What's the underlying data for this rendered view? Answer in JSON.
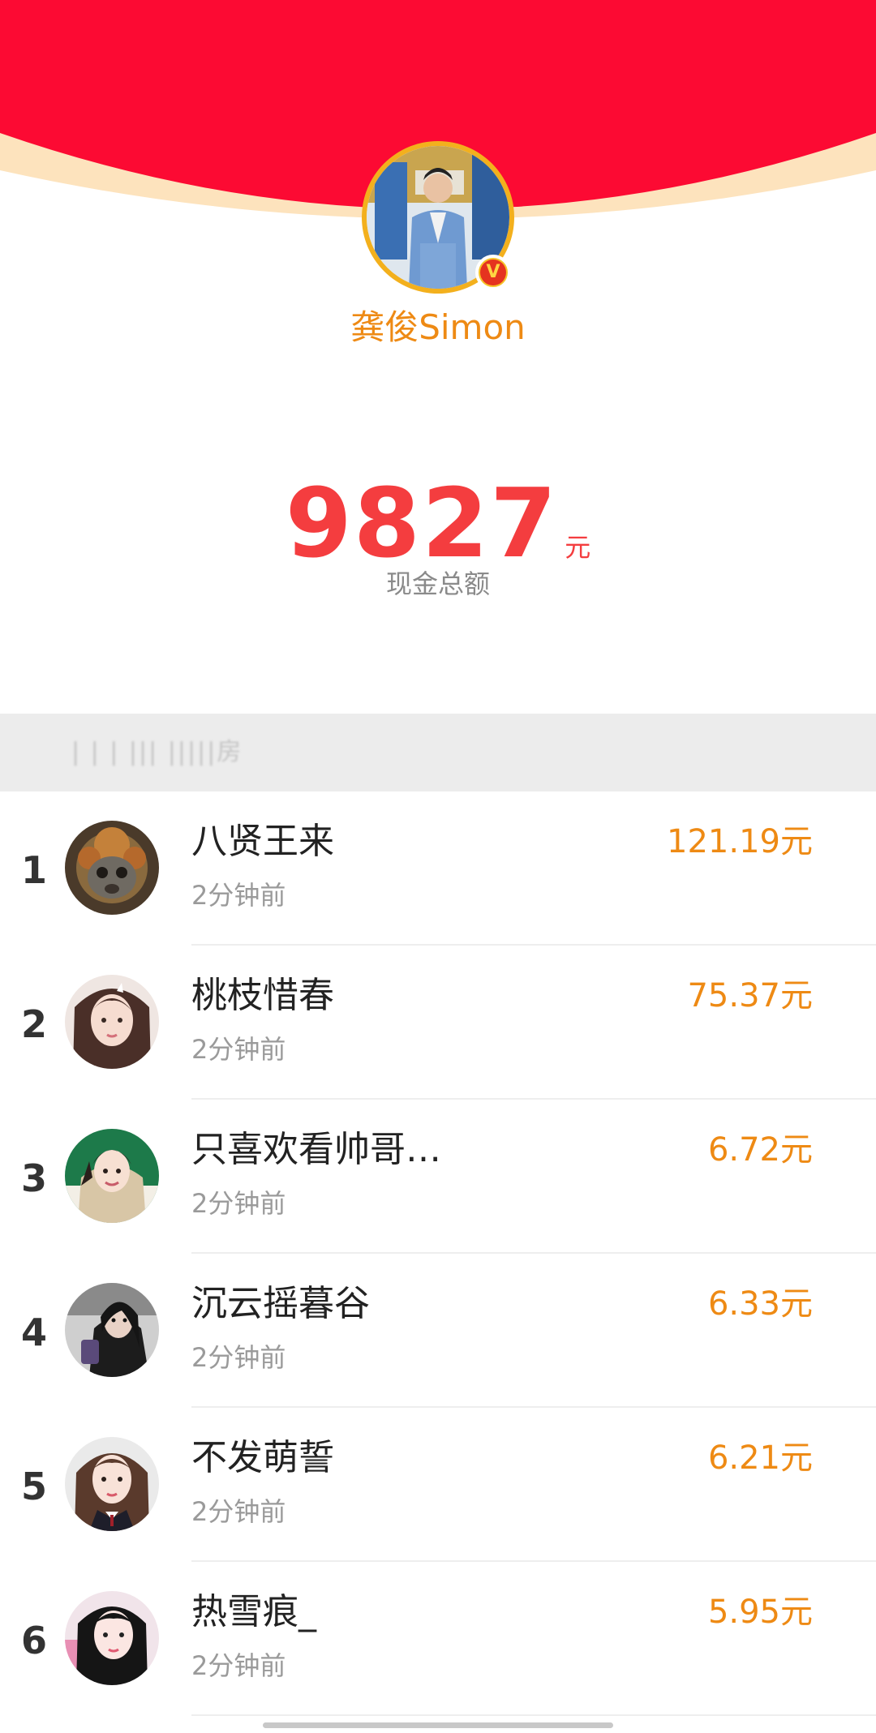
{
  "profile": {
    "name": "龚俊Simon",
    "verified_badge": "V"
  },
  "total": {
    "amount": "9827",
    "unit": "元",
    "label": "现金总额"
  },
  "section": {
    "title": "| | | ||| |||||房"
  },
  "list": [
    {
      "rank": "1",
      "name": "八贤王来",
      "time": "2分钟前",
      "amount": "121.19元"
    },
    {
      "rank": "2",
      "name": "桃枝惜春",
      "time": "2分钟前",
      "amount": "75.37元"
    },
    {
      "rank": "3",
      "name": "只喜欢看帅哥…",
      "time": "2分钟前",
      "amount": "6.72元"
    },
    {
      "rank": "4",
      "name": "沉云摇暮谷",
      "time": "2分钟前",
      "amount": "6.33元"
    },
    {
      "rank": "5",
      "name": "不发萌誓",
      "time": "2分钟前",
      "amount": "6.21元"
    },
    {
      "rank": "6",
      "name": "热雪痕_",
      "time": "2分钟前",
      "amount": "5.95元"
    }
  ],
  "colors": {
    "header_red": "#fc0a33",
    "header_rim": "#fde3bd",
    "accent_orange": "#ee8a14",
    "amount_red": "#f43d3f"
  }
}
